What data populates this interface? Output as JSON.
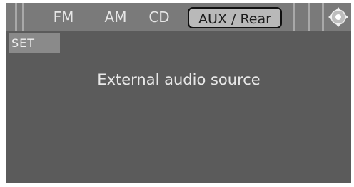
{
  "tabs": {
    "fm": "FM",
    "am": "AM",
    "cd": "CD",
    "aux": "AUX / Rear"
  },
  "active_tab": "AUX / Rear",
  "set_label": "SET",
  "message": "External audio source",
  "icons": {
    "nav": "navigation-pad-icon"
  },
  "colors": {
    "screen_bg": "#5b5b5b",
    "top_bar_bg": "#7a7a7a",
    "active_tab_bg": "#b9b9b9",
    "text": "#e6e6e6"
  }
}
